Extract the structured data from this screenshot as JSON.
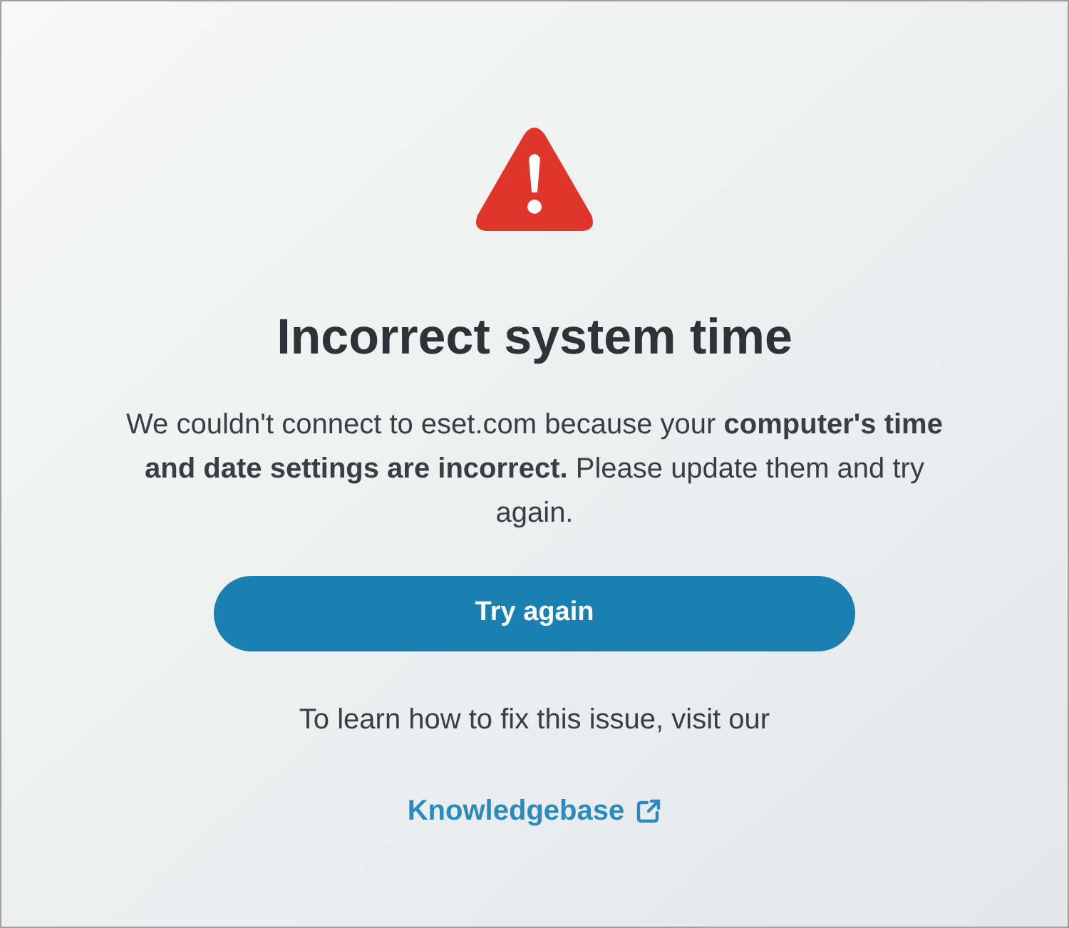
{
  "title": "Incorrect system time",
  "message": "We couldn't connect to eset.com because your **computer's time and date settings are incorrect.** Please update them and try again.",
  "button": "Try again",
  "help_text": "To learn how to fix this issue, visit our",
  "link": "Knowledgebase"
}
